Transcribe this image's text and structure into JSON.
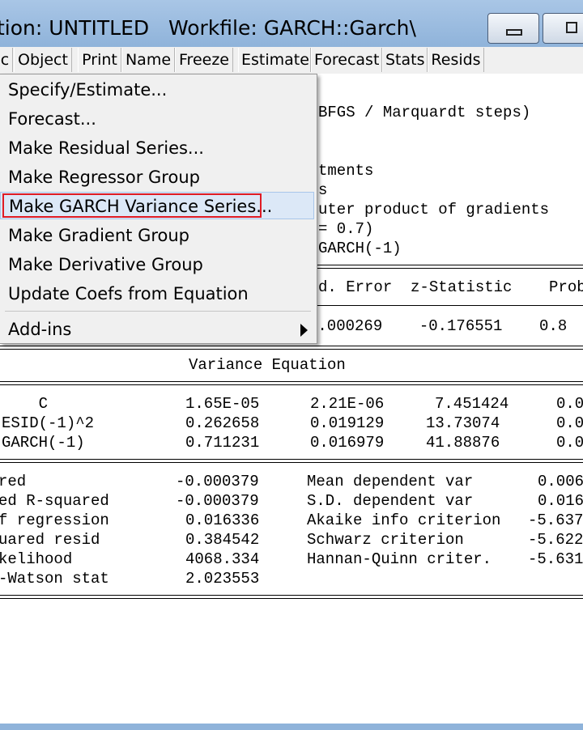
{
  "window": {
    "title": "tion: UNTITLED   Workfile: GARCH::Garch\\",
    "controls": [
      "minimize-icon",
      "restore-icon"
    ]
  },
  "toolbar": {
    "buttons": [
      "c",
      "Object",
      "Print",
      "Name",
      "Freeze",
      "Estimate",
      "Forecast",
      "Stats",
      "Resids"
    ]
  },
  "output": {
    "header_fragments": [
      "BFGS / Marquardt steps)",
      "tments",
      "s",
      "uter product of gradients",
      "= 0.7)",
      "GARCH(-1)"
    ],
    "coef_header": "d. Error  z-Statistic    Prob",
    "mean_row": ").000269    -0.176551    0.8",
    "variance_title": "Variance Equation",
    "variance_rows": [
      {
        "label": "    C",
        "coef": "1.65E-05",
        "se": "2.21E-06",
        "z": "7.451424",
        "prob": "0.0"
      },
      {
        "label": "ESID(-1)^2",
        "coef": "0.262658",
        "se": "0.019129",
        "z": "13.73074",
        "prob": "0.0"
      },
      {
        "label": "GARCH(-1)",
        "coef": "0.711231",
        "se": "0.016979",
        "z": "41.88876",
        "prob": "0.0"
      }
    ],
    "stats_left": [
      {
        "label": "red",
        "value": "-0.000379"
      },
      {
        "label": "ed R-squared",
        "value": "-0.000379"
      },
      {
        "label": "f regression",
        "value": "0.016336"
      },
      {
        "label": "uared resid",
        "value": "0.384542"
      },
      {
        "label": "kelihood",
        "value": "4068.334"
      },
      {
        "label": "-Watson stat",
        "value": "2.023553"
      }
    ],
    "stats_right": [
      {
        "label": "Mean dependent var",
        "value": "0.006"
      },
      {
        "label": "S.D. dependent var",
        "value": "0.016"
      },
      {
        "label": "Akaike info criterion",
        "value": "-5.637"
      },
      {
        "label": "Schwarz criterion",
        "value": "-5.622"
      },
      {
        "label": "Hannan-Quinn criter.",
        "value": "-5.631"
      }
    ]
  },
  "context_menu": {
    "items": [
      {
        "label": "Specify/Estimate...",
        "highlighted": false
      },
      {
        "label": "Forecast...",
        "highlighted": false
      },
      {
        "label": "Make Residual Series...",
        "highlighted": false
      },
      {
        "label": "Make Regressor Group",
        "highlighted": false
      },
      {
        "label": "Make GARCH Variance Series...",
        "highlighted": true
      },
      {
        "label": "Make Gradient Group",
        "highlighted": false
      },
      {
        "label": "Make Derivative Group",
        "highlighted": false
      },
      {
        "label": "Update Coefs from Equation",
        "highlighted": false
      },
      {
        "label": "Add-ins",
        "highlighted": false,
        "submenu": true
      }
    ]
  },
  "colors": {
    "titlebar": "#a9c6e6",
    "highlight_box": "#e01b24",
    "menu_highlight": "#dce8f7"
  }
}
